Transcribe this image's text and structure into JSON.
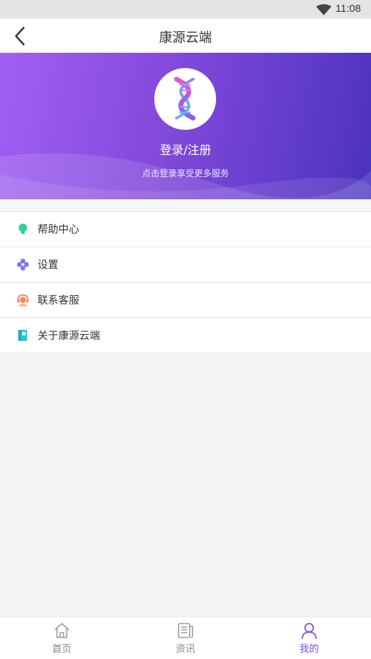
{
  "status_bar": {
    "time": "11:08",
    "icons": [
      "wifi-icon"
    ]
  },
  "navbar": {
    "title": "康源云端",
    "back_icon": "back-arrow-icon"
  },
  "profile": {
    "login_title": "登录/注册",
    "login_subtitle": "点击登录享受更多服务",
    "avatar_icon": "dna-logo-icon"
  },
  "menu": {
    "items": [
      {
        "label": "帮助中心",
        "icon": "lightbulb-icon",
        "color": "#2ecf9a"
      },
      {
        "label": "设置",
        "icon": "gear-flower-icon",
        "color": "#7b76f0"
      },
      {
        "label": "联系客服",
        "icon": "headset-icon",
        "color": "#f48a5f"
      },
      {
        "label": "关于康源云端",
        "icon": "book-icon",
        "color": "#2ec3d6"
      }
    ]
  },
  "tabbar": {
    "tabs": [
      {
        "label": "首页",
        "icon": "home-icon",
        "active": false
      },
      {
        "label": "资讯",
        "icon": "news-icon",
        "active": false
      },
      {
        "label": "我的",
        "icon": "user-icon",
        "active": true
      }
    ]
  },
  "colors": {
    "accent": "#7a4fd6",
    "banner_start": "#a160f4",
    "banner_end": "#4b33bf"
  }
}
